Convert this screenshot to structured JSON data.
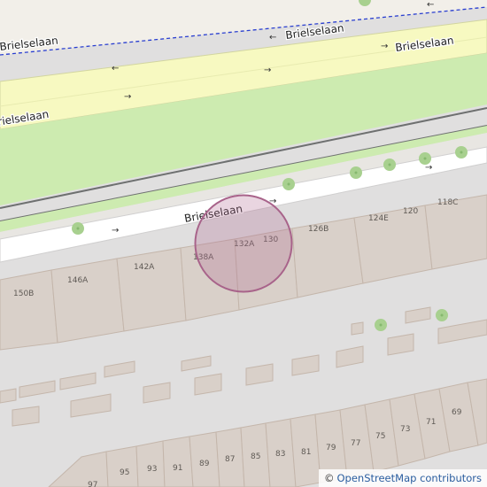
{
  "map": {
    "street_name": "Brielselaan",
    "house_numbers": {
      "n150B": "150B",
      "n146A": "146A",
      "n142A": "142A",
      "n138A": "138A",
      "n132A": "132A",
      "n130": "130",
      "n126B": "126B",
      "n124E": "124E",
      "n120": "120",
      "n118C": "118C",
      "n97": "97",
      "n95": "95",
      "n93": "93",
      "n91": "91",
      "n89": "89",
      "n87": "87",
      "n85": "85",
      "n83": "83",
      "n81": "81",
      "n79": "79",
      "n77": "77",
      "n75": "75",
      "n73": "73",
      "n71": "71",
      "n69": "69"
    },
    "marker": {
      "type": "location-circle",
      "color": "#b1698f"
    },
    "colors": {
      "background": "#e0dfdf",
      "road": "#f7f9c1",
      "grass": "#cdebb0",
      "building": "#d9d0c9",
      "building_outline": "#c4b6ab",
      "tree": "#a8d08f"
    }
  },
  "attribution": {
    "symbol": "©",
    "text": "OpenStreetMap contributors"
  }
}
